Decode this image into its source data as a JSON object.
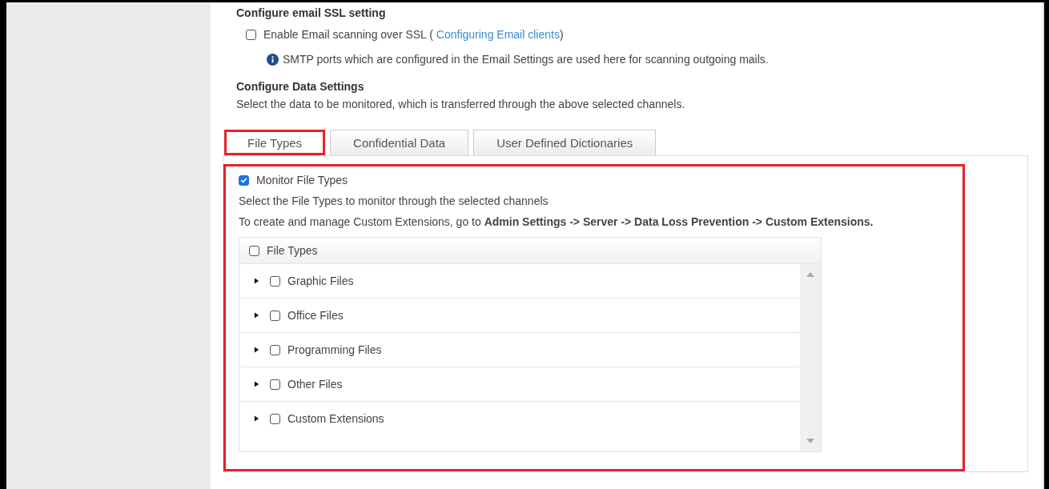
{
  "ssl_section": {
    "heading": "Configure email SSL setting",
    "checkbox": {
      "label_prefix": "Enable Email scanning over SSL ( ",
      "link": "Configuring Email clients",
      "label_suffix": ")",
      "checked": false
    },
    "info": "SMTP ports which are configured in the Email Settings are used here for scanning outgoing mails."
  },
  "data_section": {
    "heading": "Configure Data Settings",
    "description": "Select the data to be monitored, which is transferred through the above selected channels."
  },
  "tabs": [
    {
      "label": "File Types",
      "selected": true,
      "highlighted": true
    },
    {
      "label": "Confidential Data",
      "selected": false,
      "highlighted": false
    },
    {
      "label": "User Defined Dictionaries",
      "selected": false,
      "highlighted": false
    }
  ],
  "panel": {
    "highlighted": true,
    "monitor": {
      "label": "Monitor File Types",
      "checked": true
    },
    "hint": "Select the File Types to monitor through the selected channels",
    "instructions": "To create and manage Custom Extensions, go to **Admin Settings -> Server -> Data Loss Prevention -> Custom Extensions.**",
    "tree": {
      "header": {
        "label": "File Types",
        "checked": false
      },
      "rows": [
        {
          "label": "Graphic Files",
          "checked": false,
          "expanded": false
        },
        {
          "label": "Office Files",
          "checked": false,
          "expanded": false
        },
        {
          "label": "Programming Files",
          "checked": false,
          "expanded": false
        },
        {
          "label": "Other Files",
          "checked": false,
          "expanded": false
        },
        {
          "label": "Custom Extensions",
          "checked": false,
          "expanded": false
        }
      ]
    }
  }
}
